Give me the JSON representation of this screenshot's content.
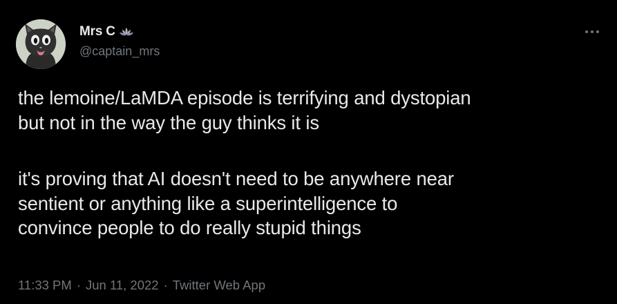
{
  "tweet": {
    "author": {
      "display_name": "Mrs C",
      "handle": "@captain_mrs",
      "avatar_icon": "cat-avatar-icon",
      "badge_icon": "lotus-icon"
    },
    "more_icon": "more-options-icon",
    "text": {
      "line1": "the lemoine/LaMDA episode is terrifying and dystopian",
      "line2": "but not in the way the guy thinks it is",
      "line3": "it's proving that AI doesn't need to be anywhere near",
      "line4": "sentient or anything like a superintelligence to",
      "line5": "convince people to do really stupid things"
    },
    "meta": {
      "time": "11:33 PM",
      "separator": "·",
      "date": "Jun 11, 2022",
      "source": "Twitter Web App"
    }
  },
  "colors": {
    "background": "#000000",
    "text": "#e7e9ea",
    "secondary": "#71767b"
  }
}
